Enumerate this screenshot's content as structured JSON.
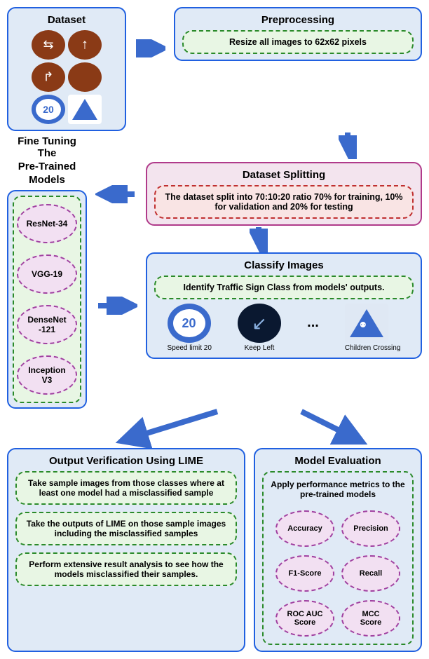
{
  "dataset": {
    "title": "Dataset"
  },
  "preprocessing": {
    "title": "Preprocessing",
    "text": "Resize all images to 62x62 pixels"
  },
  "fine_tuning": {
    "title_line1": "Fine Tuning The",
    "title_line2": "Pre-Trained",
    "title_line3": "Models",
    "models": [
      "ResNet-34",
      "VGG-19",
      "DenseNet\n-121",
      "Inception\nV3"
    ]
  },
  "splitting": {
    "title": "Dataset Splitting",
    "text": "The dataset split into 70:10:20 ratio 70% for training, 10% for validation and 20% for testing"
  },
  "classify": {
    "title": "Classify Images",
    "subtitle": "Identify Traffic Sign Class from models' outputs.",
    "captions": [
      "Speed limit 20",
      "Keep Left",
      "Children Crossing"
    ],
    "dots": "..."
  },
  "lime": {
    "title": "Output Verification Using LIME",
    "steps": [
      "Take sample images from those classes where at least one model had a misclassified sample",
      "Take the outputs of LIME on those sample images including the misclassified samples",
      "Perform extensive result analysis to see how the models misclassified their samples."
    ]
  },
  "eval": {
    "title": "Model Evaluation",
    "subtitle": "Apply performance metrics to the pre-trained models",
    "metrics": [
      "Accuracy",
      "Precision",
      "F1-Score",
      "Recall",
      "ROC AUC\nScore",
      "MCC\nScore"
    ]
  }
}
